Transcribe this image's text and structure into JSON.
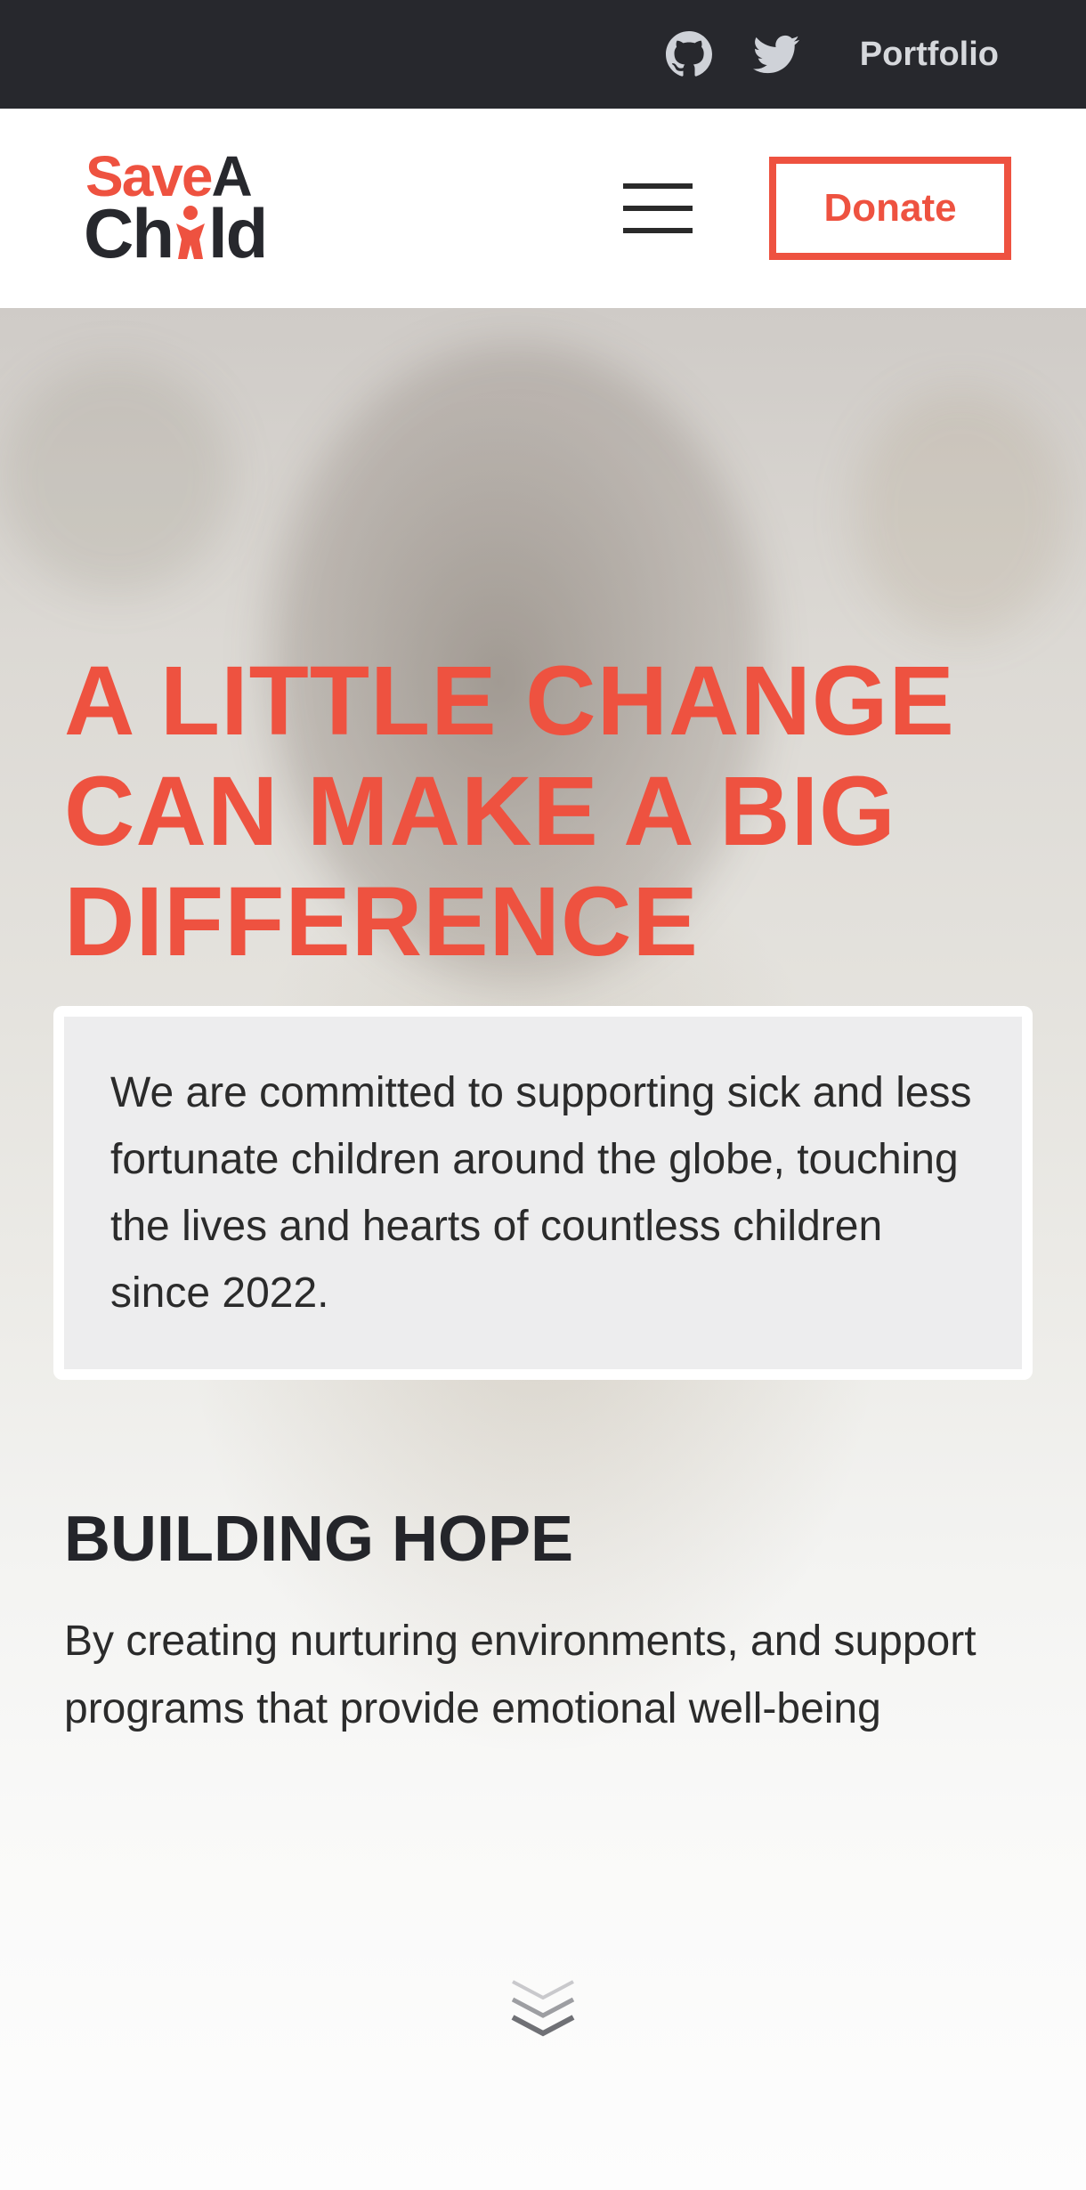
{
  "topbar": {
    "github_icon": "github-icon",
    "twitter_icon": "twitter-icon",
    "portfolio_label": "Portfolio"
  },
  "logo": {
    "save": "Save",
    "a": "A",
    "ch": "Ch",
    "ld": "ld"
  },
  "nav": {
    "menu_icon": "hamburger-menu-icon",
    "donate_label": "Donate"
  },
  "hero": {
    "title": "A LITTLE CHANGE CAN MAKE A BIG DIFFERENCE",
    "mission": "We are committed to supporting sick and less fortunate children around the globe, touching the lives and hearts of countless children since 2022.",
    "section_title": "BUILDING HOPE",
    "section_text": "By creating nurturing environments, and support programs that provide emotional well-being",
    "scroll_icon": "double-chevron-down-icon"
  },
  "colors": {
    "accent": "#ee5240",
    "topbar_bg": "#27282d",
    "dark_text": "#24252a"
  }
}
